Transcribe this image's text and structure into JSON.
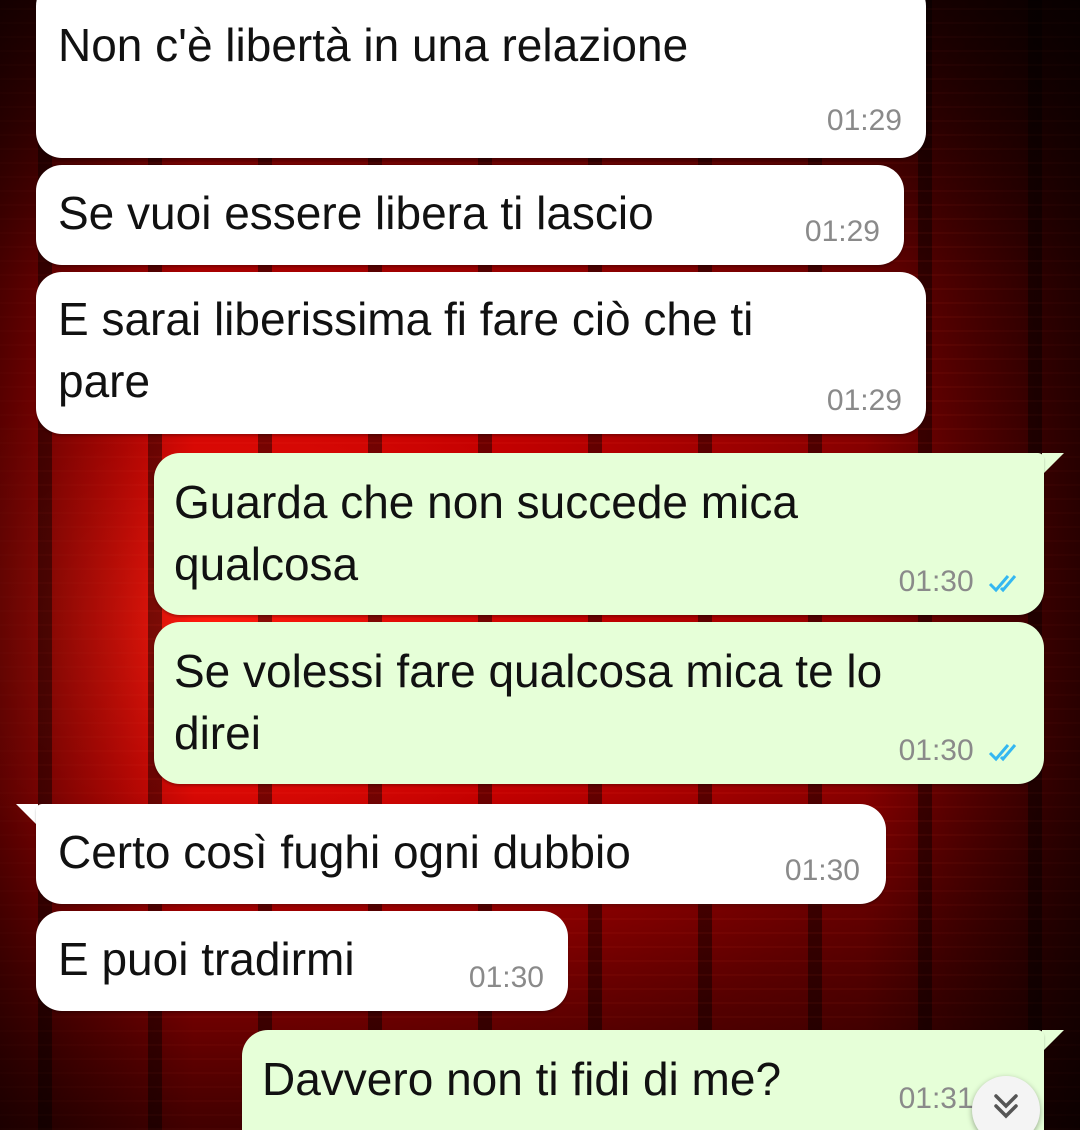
{
  "conversation": {
    "messages": [
      {
        "direction": "in",
        "lines": [
          "Non c'è libertà in una relazione"
        ],
        "time": "01:29"
      },
      {
        "direction": "in",
        "lines": [
          "Se vuoi essere libera ti lascio"
        ],
        "time": "01:29"
      },
      {
        "direction": "in",
        "lines": [
          "E sarai liberissima fi fare ciò che ti",
          "pare"
        ],
        "time": "01:29"
      },
      {
        "direction": "out",
        "lines": [
          "Guarda che non succede mica",
          "qualcosa"
        ],
        "time": "01:30",
        "status": "read"
      },
      {
        "direction": "out",
        "lines": [
          "Se volessi fare qualcosa mica te lo",
          "direi"
        ],
        "time": "01:30",
        "status": "read"
      },
      {
        "direction": "in",
        "lines": [
          "Certo così fughi ogni dubbio"
        ],
        "time": "01:30"
      },
      {
        "direction": "in",
        "lines": [
          "E puoi tradirmi"
        ],
        "time": "01:30"
      },
      {
        "direction": "out",
        "lines": [
          "Davvero non ti fidi di me?"
        ],
        "time": "01:31",
        "status": "read"
      }
    ]
  },
  "icons": {
    "read_receipt": "double-check-icon",
    "scroll_down": "double-chevron-down-icon"
  },
  "colors": {
    "incoming_bubble": "#ffffff",
    "outgoing_bubble": "#e6ffd8",
    "timestamp": "#8a8a8a",
    "read_tick": "#34b7f1",
    "wallpaper": "#c40000"
  }
}
